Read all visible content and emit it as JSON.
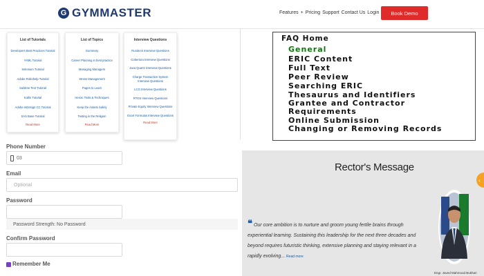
{
  "header": {
    "logo_letter": "G",
    "logo_text": "GYMMASTER",
    "nav": [
      "Features",
      "+",
      "Pricing",
      "Support",
      "Contact Us",
      "Login"
    ],
    "demo_label": "Book Demo",
    "accent": "#e02b2b",
    "brand": "#1e3a6e"
  },
  "tutorial_cards": [
    {
      "title": "List of Tutorials",
      "items": [
        "Developers Best Practices Tutorial",
        "YAML Tutorial",
        "Selenium Tutorial",
        "Adobe Robohelp Tutorial",
        "Sublime Text Tutorial",
        "Kotlin Tutorial",
        "Adobe InDesign CC Tutorial",
        "SAS Base Tutorial"
      ],
      "more": "Read More"
    },
    {
      "title": "List of Topics",
      "items": [
        "Gummary",
        "Career Planning in best practice",
        "Managing Managers",
        "Stress Management",
        "Pages to Learn",
        "Heroic Tools & Techniques",
        "Keep the Assets Safely",
        "Testing in the Religion"
      ],
      "more": "Read More"
    },
    {
      "title": "Interview Questions",
      "items": [
        "Rundeck Interview Questions",
        "Cobertura Interview Questions",
        "Java Quartz Interview Questions",
        "Charge Transaction System Interview Questions",
        "LCG Interview Questions",
        "RTOS Interview Questions",
        "Private Equity Interview Questions",
        "Excel Formulas Interview Questions"
      ],
      "more": "Read More"
    }
  ],
  "form": {
    "phone_label": "Phone Number",
    "phone_value": "03",
    "email_label": "Email",
    "email_placeholder": "Optional",
    "password_label": "Password",
    "strength_text": "Password Strength: No Password",
    "confirm_label": "Confirm Password",
    "remember_label": "Remember Me",
    "remember_checked": true,
    "check_color": "#7a3fc8"
  },
  "faq": {
    "title": "FAQ Home",
    "items": [
      "General",
      "ERIC Content",
      "Full Text",
      "Peer Review",
      "Searching ERIC",
      "Thesaurus and Identifiers",
      "Grantee and Contractor Requirements",
      "Online Submission",
      "Changing or Removing Records"
    ],
    "active_color": "#0a7a0a"
  },
  "rector": {
    "title": "Rector's Message",
    "quote": "Our core ambition is to nurture and groom young fertile brains through experiential learning. Sustaining this leadership for the next three decades and beyond requires futuristic thinking, extensive planning and staying relevant in a rapidly evolving...",
    "read_more": "Read more",
    "name": "Engr. Javed Mahmood Bukhari"
  }
}
